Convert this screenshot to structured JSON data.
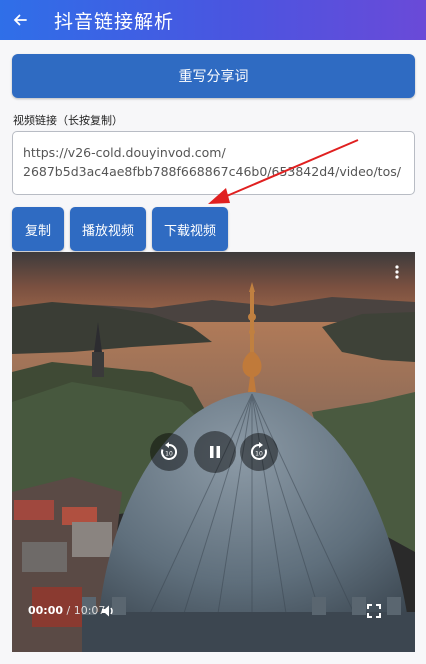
{
  "appbar": {
    "title": "抖音链接解析",
    "back_icon": "arrow-back-icon"
  },
  "actions": {
    "rewrite_label": "重写分享词"
  },
  "link": {
    "label": "视频链接（长按复制）",
    "line1": "https://v26-cold.douyinvod.com/",
    "line2": "2687b5d3ac4ae8fbb788f668867c46b0/653842d4/video/tos/"
  },
  "buttons": {
    "copy": "复制",
    "play": "播放视频",
    "download": "下载视频"
  },
  "player": {
    "current_time": "00:00",
    "separator": " / ",
    "duration": "10:07",
    "is_playing": true
  },
  "colors": {
    "primary": "#2f6bc2",
    "appbar_start": "#2f6fe8",
    "appbar_end": "#6a4ad8",
    "annotation_arrow": "#e02020"
  }
}
